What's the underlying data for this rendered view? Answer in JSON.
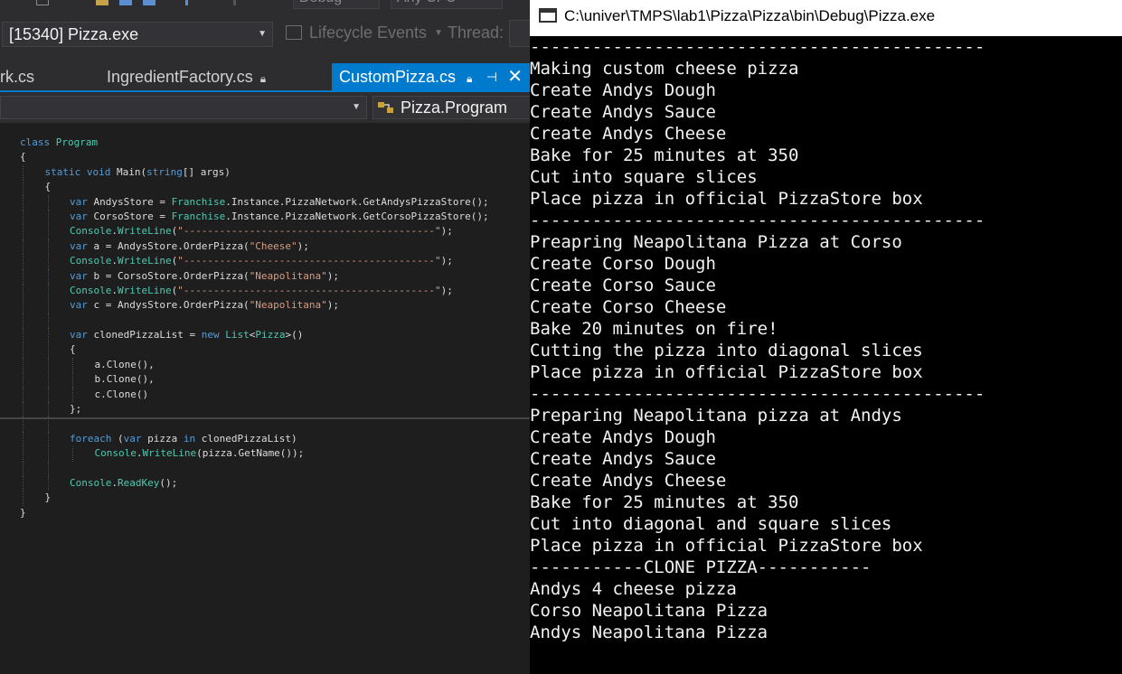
{
  "vs": {
    "toolbar": {
      "config_stub": "Debug",
      "platform_stub": "Any CPU",
      "process": "[15340] Pizza.exe",
      "lifecycle": "Lifecycle Events",
      "thread_label": "Thread:"
    },
    "tabs": [
      {
        "label": "rk.cs"
      },
      {
        "label": "IngredientFactory.cs"
      },
      {
        "label": "CustomPizza.cs"
      }
    ],
    "nav": {
      "right": "Pizza.Program"
    },
    "code": [
      {
        "indent": 0,
        "tokens": [
          [
            "kw",
            "class"
          ],
          [
            "p",
            " "
          ],
          [
            "ty",
            "Program"
          ]
        ]
      },
      {
        "indent": 0,
        "tokens": [
          [
            "p",
            "{"
          ]
        ]
      },
      {
        "indent": 1,
        "tokens": [
          [
            "kw",
            "static"
          ],
          [
            "p",
            " "
          ],
          [
            "kw",
            "void"
          ],
          [
            "p",
            " Main("
          ],
          [
            "kw",
            "string"
          ],
          [
            "p",
            "[] args)"
          ]
        ]
      },
      {
        "indent": 1,
        "tokens": [
          [
            "p",
            "{"
          ]
        ]
      },
      {
        "indent": 2,
        "tokens": [
          [
            "kw",
            "var"
          ],
          [
            "p",
            " AndysStore = "
          ],
          [
            "ty",
            "Franchise"
          ],
          [
            "p",
            ".Instance.PizzaNetwork.GetAndysPizzaStore();"
          ]
        ]
      },
      {
        "indent": 2,
        "tokens": [
          [
            "kw",
            "var"
          ],
          [
            "p",
            " CorsoStore = "
          ],
          [
            "ty",
            "Franchise"
          ],
          [
            "p",
            ".Instance.PizzaNetwork.GetCorsoPizzaStore();"
          ]
        ]
      },
      {
        "indent": 2,
        "tokens": [
          [
            "ty",
            "Console"
          ],
          [
            "p",
            "."
          ],
          [
            "ty",
            "WriteLine"
          ],
          [
            "p",
            "("
          ],
          [
            "st",
            "\"------------------------------------------\""
          ],
          [
            "p",
            ");"
          ]
        ]
      },
      {
        "indent": 2,
        "tokens": [
          [
            "kw",
            "var"
          ],
          [
            "p",
            " a = AndysStore.OrderPizza("
          ],
          [
            "st",
            "\"Cheese\""
          ],
          [
            "p",
            ");"
          ]
        ]
      },
      {
        "indent": 2,
        "tokens": [
          [
            "ty",
            "Console"
          ],
          [
            "p",
            "."
          ],
          [
            "ty",
            "WriteLine"
          ],
          [
            "p",
            "("
          ],
          [
            "st",
            "\"------------------------------------------\""
          ],
          [
            "p",
            ");"
          ]
        ]
      },
      {
        "indent": 2,
        "tokens": [
          [
            "kw",
            "var"
          ],
          [
            "p",
            " b = CorsoStore.OrderPizza("
          ],
          [
            "st",
            "\"Neapolitana\""
          ],
          [
            "p",
            ");"
          ]
        ]
      },
      {
        "indent": 2,
        "tokens": [
          [
            "ty",
            "Console"
          ],
          [
            "p",
            "."
          ],
          [
            "ty",
            "WriteLine"
          ],
          [
            "p",
            "("
          ],
          [
            "st",
            "\"------------------------------------------\""
          ],
          [
            "p",
            ");"
          ]
        ]
      },
      {
        "indent": 2,
        "tokens": [
          [
            "kw",
            "var"
          ],
          [
            "p",
            " c = AndysStore.OrderPizza("
          ],
          [
            "st",
            "\"Neapolitana\""
          ],
          [
            "p",
            ");"
          ]
        ]
      },
      {
        "indent": 2,
        "tokens": []
      },
      {
        "indent": 2,
        "tokens": [
          [
            "kw",
            "var"
          ],
          [
            "p",
            " clonedPizzaList = "
          ],
          [
            "kw",
            "new"
          ],
          [
            "p",
            " "
          ],
          [
            "ty",
            "List"
          ],
          [
            "p",
            "<"
          ],
          [
            "ty",
            "Pizza"
          ],
          [
            "p",
            ">()"
          ]
        ]
      },
      {
        "indent": 2,
        "tokens": [
          [
            "p",
            "{"
          ]
        ]
      },
      {
        "indent": 3,
        "tokens": [
          [
            "p",
            "a.Clone(),"
          ]
        ]
      },
      {
        "indent": 3,
        "tokens": [
          [
            "p",
            "b.Clone(),"
          ]
        ]
      },
      {
        "indent": 3,
        "tokens": [
          [
            "p",
            "c.Clone()"
          ]
        ]
      },
      {
        "indent": 2,
        "tokens": [
          [
            "p",
            "};"
          ]
        ]
      },
      {
        "indent": 2,
        "tokens": []
      },
      {
        "indent": 2,
        "tokens": [
          [
            "kw",
            "foreach"
          ],
          [
            "p",
            " ("
          ],
          [
            "kw",
            "var"
          ],
          [
            "p",
            " pizza "
          ],
          [
            "kw",
            "in"
          ],
          [
            "p",
            " clonedPizzaList)"
          ]
        ]
      },
      {
        "indent": 3,
        "tokens": [
          [
            "ty",
            "Console"
          ],
          [
            "p",
            "."
          ],
          [
            "ty",
            "WriteLine"
          ],
          [
            "p",
            "(pizza.GetName());"
          ]
        ]
      },
      {
        "indent": 2,
        "tokens": []
      },
      {
        "indent": 2,
        "tokens": [
          [
            "ty",
            "Console"
          ],
          [
            "p",
            "."
          ],
          [
            "ty",
            "ReadKey"
          ],
          [
            "p",
            "();"
          ]
        ]
      },
      {
        "indent": 1,
        "tokens": [
          [
            "p",
            "}"
          ]
        ]
      },
      {
        "indent": 0,
        "tokens": [
          [
            "p",
            "}"
          ]
        ]
      }
    ]
  },
  "console": {
    "title": "C:\\univer\\TMPS\\lab1\\Pizza\\Pizza\\bin\\Debug\\Pizza.exe",
    "lines": [
      "--------------------------------------------",
      "Making custom cheese pizza",
      "Create Andys Dough",
      "Create Andys Sauce",
      "Create Andys Cheese",
      "Bake for 25 minutes at 350",
      "Cut into square slices",
      "Place pizza in official PizzaStore box",
      "--------------------------------------------",
      "Preapring Neapolitana Pizza at Corso",
      "Create Corso Dough",
      "Create Corso Sauce",
      "Create Corso Cheese",
      "Bake 20 minutes on fire!",
      "Cutting the pizza into diagonal slices",
      "Place pizza in official PizzaStore box",
      "--------------------------------------------",
      "Preparing Neapolitana pizza at Andys",
      "Create Andys Dough",
      "Create Andys Sauce",
      "Create Andys Cheese",
      "Bake for 25 minutes at 350",
      "Cut into diagonal and square slices",
      "Place pizza in official PizzaStore box",
      "-----------CLONE PIZZA-----------",
      "Andys 4 cheese pizza",
      "Corso Neapolitana Pizza",
      "Andys Neapolitana Pizza"
    ]
  },
  "colors": {
    "accent": "#007acc",
    "keyword": "#569cd6",
    "type": "#4ec9b0",
    "string": "#d69d85"
  }
}
